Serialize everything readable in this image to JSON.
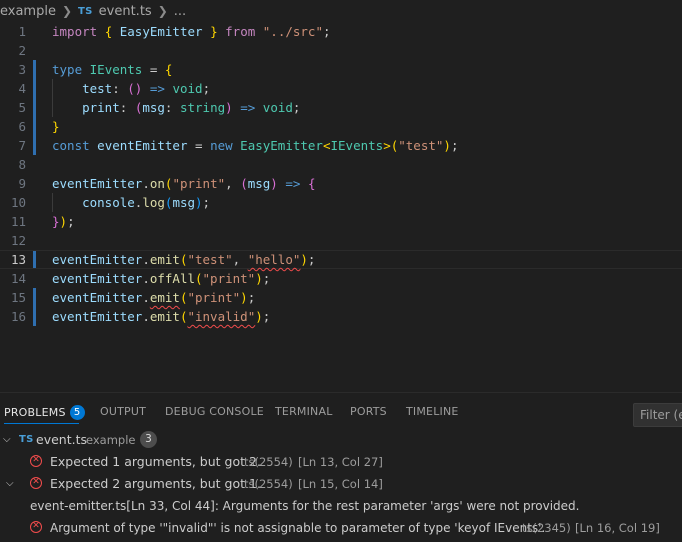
{
  "breadcrumb": {
    "folder": "example",
    "file_badge": "TS",
    "file": "event.ts",
    "more": "..."
  },
  "editor": {
    "line_numbers": [
      "1",
      "2",
      "3",
      "4",
      "5",
      "6",
      "7",
      "8",
      "9",
      "10",
      "11",
      "12",
      "13",
      "14",
      "15",
      "16"
    ]
  },
  "panel": {
    "tabs": [
      {
        "label": "PROBLEMS",
        "badge": "5"
      },
      {
        "label": "OUTPUT"
      },
      {
        "label": "DEBUG CONSOLE"
      },
      {
        "label": "TERMINAL"
      },
      {
        "label": "PORTS"
      },
      {
        "label": "TIMELINE"
      }
    ],
    "filter_placeholder": "Filter (e.g.",
    "file_group": {
      "badge": "TS",
      "file": "event.ts",
      "folder": "example",
      "count": "3"
    },
    "problems": [
      {
        "message": "Expected 1 arguments, but got 2.",
        "code": "ts(2554)",
        "location": "[Ln 13, Col 27]"
      },
      {
        "message": "Expected 2 arguments, but got 1.",
        "code": "ts(2554)",
        "location": "[Ln 15, Col 14]"
      },
      {
        "related": "event-emitter.ts[Ln 33, Col 44]: Arguments for the rest parameter 'args' were not provided."
      },
      {
        "message": "Argument of type '\"invalid\"' is not assignable to parameter of type 'keyof IEvents'.",
        "code": "ts(2345)",
        "location": "[Ln 16, Col 19]"
      }
    ]
  },
  "colors": {
    "accent": "#0078d4",
    "error": "#f14c4c",
    "modified_gutter": "#2f6fb0"
  },
  "icons": [
    "chevron-right-icon",
    "chevron-down-icon",
    "error-icon",
    "typescript-file-icon"
  ]
}
